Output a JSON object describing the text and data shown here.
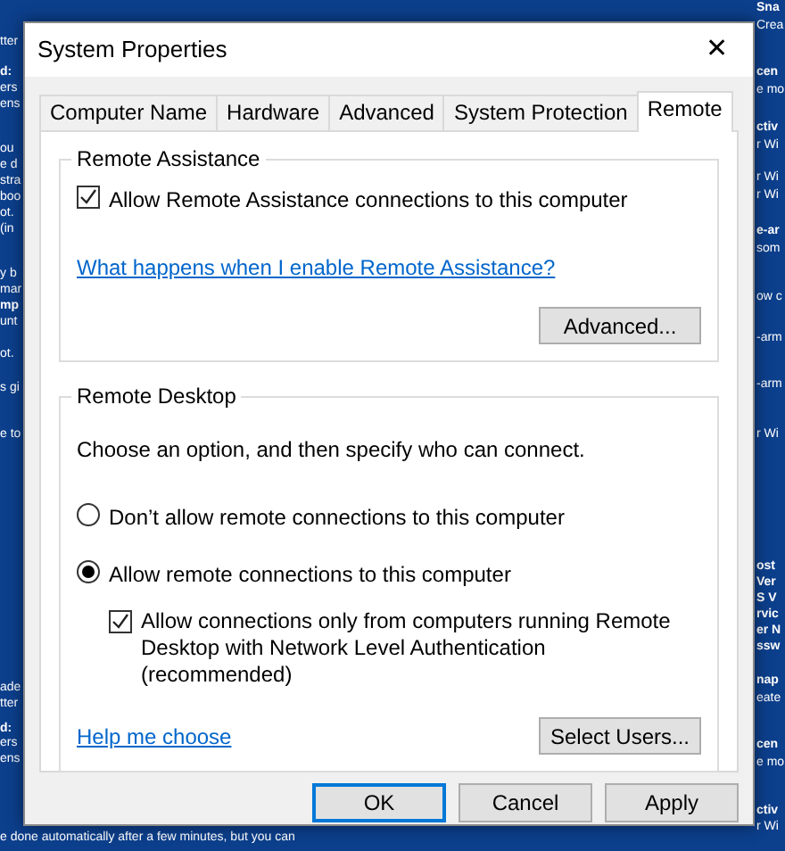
{
  "desktop": {
    "left_text": [
      {
        "text": "tter",
        "bold": false
      },
      {
        "text": "d:",
        "bold": true
      },
      {
        "text": "ers",
        "bold": false
      },
      {
        "text": "ens",
        "bold": false
      },
      {
        "text": "ou",
        "bold": false
      },
      {
        "text": "e d",
        "bold": false
      },
      {
        "text": "stra",
        "bold": false
      },
      {
        "text": "boo",
        "bold": false
      },
      {
        "text": "ot.",
        "bold": false
      },
      {
        "text": "(in",
        "bold": false
      },
      {
        "text": "y b",
        "bold": false
      },
      {
        "text": "mar",
        "bold": false
      },
      {
        "text": "mp",
        "bold": true
      },
      {
        "text": "unt",
        "bold": false
      },
      {
        "text": "ot.",
        "bold": false
      },
      {
        "text": "s gi",
        "bold": false
      },
      {
        "text": "e to",
        "bold": false
      },
      {
        "text": "ade",
        "bold": false
      },
      {
        "text": "tter",
        "bold": false
      },
      {
        "text": "d:",
        "bold": true
      },
      {
        "text": "ers",
        "bold": false
      },
      {
        "text": "ens",
        "bold": false
      },
      {
        "text": "e done automatically after a few minutes, but you can",
        "bold": false
      }
    ],
    "right_text": [
      {
        "text": "Sna",
        "bold": true
      },
      {
        "text": "Crea",
        "bold": false
      },
      {
        "text": "cen",
        "bold": true
      },
      {
        "text": "e mo",
        "bold": false
      },
      {
        "text": "ctiv",
        "bold": true
      },
      {
        "text": "r Wi",
        "bold": false
      },
      {
        "text": "r Wi",
        "bold": false
      },
      {
        "text": "r Wi",
        "bold": false
      },
      {
        "text": "e-ar",
        "bold": true
      },
      {
        "text": "som",
        "bold": false
      },
      {
        "text": "ow c",
        "bold": false
      },
      {
        "text": "-arm",
        "bold": false
      },
      {
        "text": "-arm",
        "bold": false
      },
      {
        "text": "r Wi",
        "bold": false
      },
      {
        "text": "ost",
        "bold": true
      },
      {
        "text": "Ver",
        "bold": true
      },
      {
        "text": "S V",
        "bold": true
      },
      {
        "text": "rvic",
        "bold": true
      },
      {
        "text": "er N",
        "bold": true
      },
      {
        "text": "ssw",
        "bold": true
      },
      {
        "text": "nap",
        "bold": true
      },
      {
        "text": "eate",
        "bold": false
      },
      {
        "text": "cen",
        "bold": true
      },
      {
        "text": "e mo",
        "bold": false
      },
      {
        "text": "ctiv",
        "bold": true
      },
      {
        "text": "r Wi",
        "bold": false
      }
    ]
  },
  "window": {
    "title": "System Properties",
    "close": "✕"
  },
  "tabs": [
    {
      "label": "Computer Name",
      "selected": false
    },
    {
      "label": "Hardware",
      "selected": false
    },
    {
      "label": "Advanced",
      "selected": false
    },
    {
      "label": "System Protection",
      "selected": false
    },
    {
      "label": "Remote",
      "selected": true
    }
  ],
  "remote_assistance": {
    "title": "Remote Assistance",
    "checkbox": {
      "label": "Allow Remote Assistance connections to this computer",
      "checked": true
    },
    "link": "What happens when I enable Remote Assistance?",
    "button": "Advanced..."
  },
  "remote_desktop": {
    "title": "Remote Desktop",
    "intro": "Choose an option, and then specify who can connect.",
    "options": [
      {
        "label": "Don’t allow remote connections to this computer",
        "selected": false
      },
      {
        "label": "Allow remote connections to this computer",
        "selected": true
      }
    ],
    "nla": {
      "label": "Allow connections only from computers running Remote Desktop with Network Level Authentication (recommended)",
      "checked": true
    },
    "link": "Help me choose",
    "button": "Select Users..."
  },
  "buttons": [
    {
      "label": "OK",
      "default": true
    },
    {
      "label": "Cancel",
      "default": false
    },
    {
      "label": "Apply",
      "default": false
    }
  ]
}
